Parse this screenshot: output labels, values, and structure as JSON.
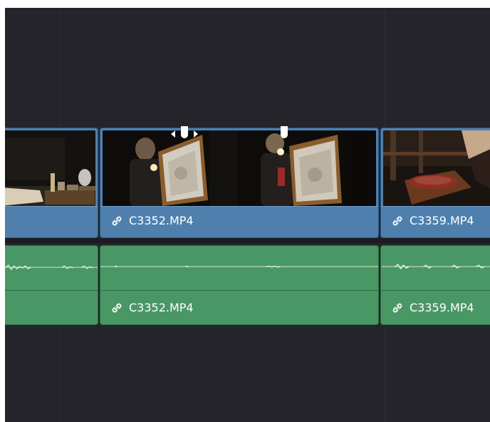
{
  "timeline": {
    "video_track": {
      "clips": [
        {
          "name": "",
          "linked": false
        },
        {
          "name": "C3352.MP4",
          "linked": true,
          "icon": "link-icon"
        },
        {
          "name": "C3359.MP4",
          "linked": true,
          "icon": "link-icon"
        }
      ]
    },
    "audio_track": {
      "clips": [
        {
          "name": "",
          "linked": false
        },
        {
          "name": "C3352.MP4",
          "linked": true,
          "icon": "link-icon"
        },
        {
          "name": "C3359.MP4",
          "linked": true,
          "icon": "link-icon"
        }
      ]
    },
    "colors": {
      "background": "#24242a",
      "video_clip": "#4f80ad",
      "audio_clip": "#4a9766"
    }
  }
}
